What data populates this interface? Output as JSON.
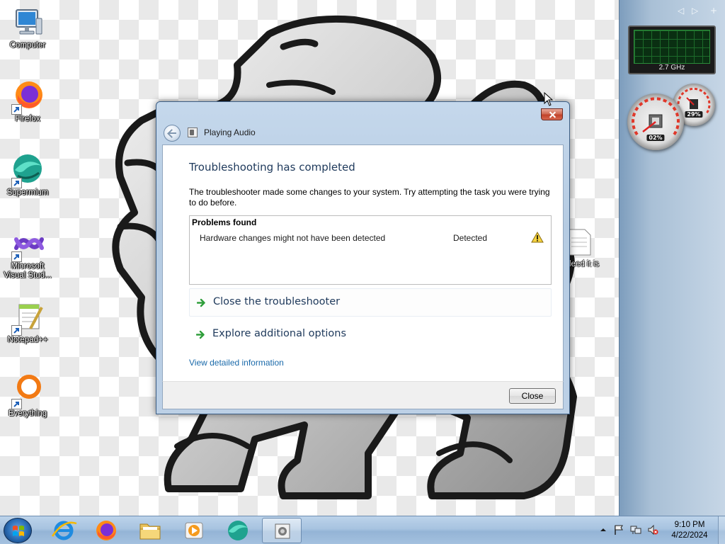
{
  "desktop": {
    "icons": [
      {
        "label": "Computer"
      },
      {
        "label": "Firefox"
      },
      {
        "label": "Supermium"
      },
      {
        "label": "Microsoft Visual Stud..."
      },
      {
        "label": "Notepad++"
      },
      {
        "label": "Everything"
      }
    ],
    "partial_file_label": "leed it is"
  },
  "gadgets": {
    "cpu_frequency": "2.7 GHz",
    "cpu_usage": "02%",
    "memory_usage": "29%"
  },
  "dialog": {
    "title": "Playing Audio",
    "heading": "Troubleshooting has completed",
    "description": "The troubleshooter made some changes to your system. Try attempting the task you were trying to do before.",
    "problems_header": "Problems found",
    "problems": [
      {
        "name": "Hardware changes might not have been detected",
        "status": "Detected",
        "icon": "warning-icon"
      }
    ],
    "commands": [
      {
        "label": "Close the troubleshooter"
      },
      {
        "label": "Explore additional options"
      }
    ],
    "details_link": "View detailed information",
    "close_button": "Close"
  },
  "taskbar": {
    "pinned": [
      "internet-explorer",
      "firefox",
      "file-explorer",
      "media-player",
      "supermium",
      "troubleshooter"
    ],
    "clock": {
      "time": "9:10 PM",
      "date": "4/22/2024"
    }
  },
  "colors": {
    "heading": "#1e395b",
    "link": "#1a6aaa",
    "command_arrow": "#2f9e3b"
  }
}
